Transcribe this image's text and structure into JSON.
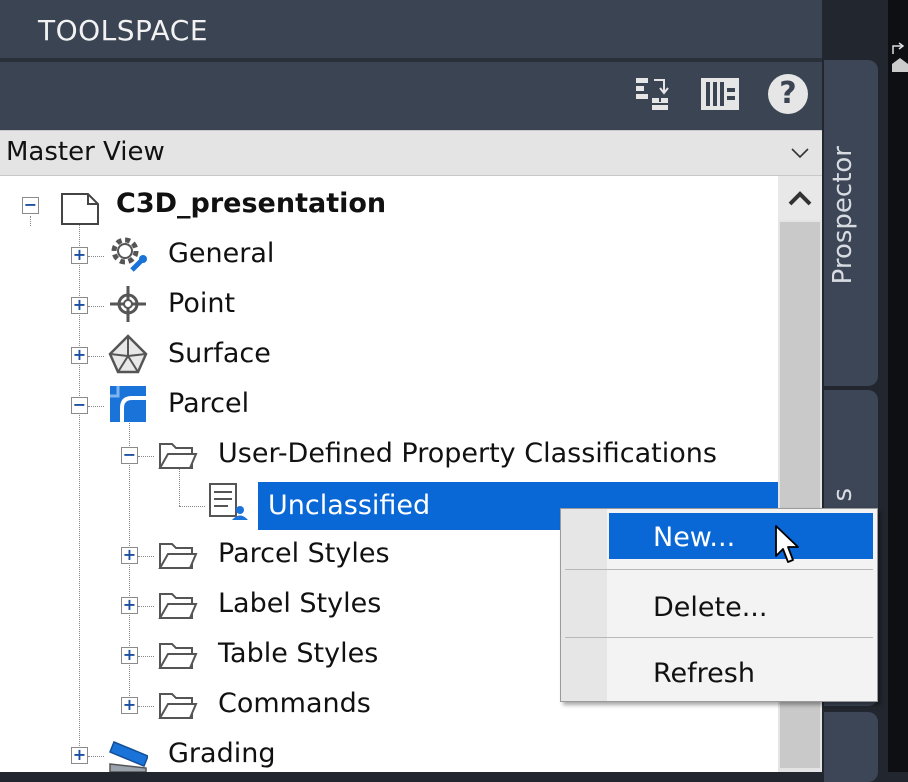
{
  "palette": {
    "selection": "#0a68d6",
    "panel": "#3b4453",
    "tree_bg": "#ffffff"
  },
  "title": "TOOLSPACE",
  "toolbar": {
    "buttons": [
      {
        "icon": "tree-view-toggle-icon"
      },
      {
        "icon": "list-view-icon"
      },
      {
        "icon": "help-icon",
        "glyph": "?"
      }
    ]
  },
  "view_select": {
    "value": "Master View"
  },
  "tree": {
    "root": "C3D_presentation",
    "items": [
      {
        "label": "General",
        "icon": "gear-wrench-icon",
        "expander": "+"
      },
      {
        "label": "Point",
        "icon": "point-icon",
        "expander": "+"
      },
      {
        "label": "Surface",
        "icon": "surface-icon",
        "expander": "+"
      },
      {
        "label": "Parcel",
        "icon": "parcel-icon",
        "expander": "−"
      },
      {
        "label": "User-Defined Property Classifications",
        "icon": "folder-icon",
        "expander": "−"
      },
      {
        "label": "Unclassified",
        "icon": "classification-icon",
        "selected": true
      },
      {
        "label": "Parcel Styles",
        "icon": "folder-icon",
        "expander": "+"
      },
      {
        "label": "Label Styles",
        "icon": "folder-icon",
        "expander": "+"
      },
      {
        "label": "Table Styles",
        "icon": "folder-icon",
        "expander": "+"
      },
      {
        "label": "Commands",
        "icon": "folder-icon",
        "expander": "+"
      },
      {
        "label": "Grading",
        "icon": "grading-icon",
        "expander": "+"
      }
    ]
  },
  "side_tabs": [
    {
      "label": "Prospector"
    },
    {
      "label": "s"
    }
  ],
  "context_menu": {
    "items": [
      {
        "label": "New...",
        "highlighted": true
      },
      {
        "label": "Delete..."
      },
      {
        "label": "Refresh"
      }
    ]
  }
}
